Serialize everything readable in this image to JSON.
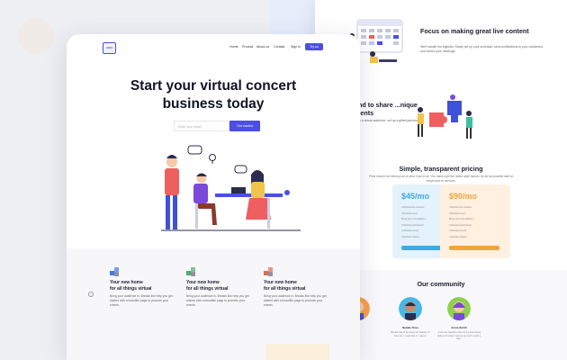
{
  "back_page": {
    "feature": {
      "title": "Focus on making great live content",
      "text": "We'll handle the logistics. Easily set up your schedule, send notifications to your customers, and record your meetings."
    },
    "talents": {
      "title": "...nd to share ...nique talents",
      "text": "...with a virtual audience, set up a gifted performer and..."
    },
    "pricing": {
      "title": "Simple, transparent pricing",
      "subtitle": "Price should not interrupt all of what I had to do. You make right the rather quite factors. As far as possible start at virtual chat on services.",
      "plans": [
        {
          "price": "",
          "color": "#fde6e6",
          "btn": "#f06565"
        },
        {
          "price": "$45/mo",
          "color": "#e4f2fb",
          "btn": "#41a9e6"
        },
        {
          "price": "$90/mo",
          "color": "#fff0e0",
          "btn": "#f3a33d"
        }
      ],
      "features": [
        "Unlimited live streams",
        "Unlimited users",
        "Bring your own platform",
        "Unlimited participants",
        "Unlimited events",
        "Unlimited classes"
      ]
    },
    "community": {
      "title": "Our community",
      "members": [
        {
          "name": "",
          "text": ""
        },
        {
          "name": "Natalie Rose",
          "text": "\"Breath has to be where art started. If I have art, I could feel it. I was it.\""
        },
        {
          "name": "Annie Smith",
          "text": "\"I love the freedom that comes from being able to do what I want to do and in such a way.\""
        }
      ]
    }
  },
  "front_page": {
    "logo": "LOGO",
    "nav": [
      "Home",
      "Product",
      "About us",
      "Contact",
      "Sign in"
    ],
    "nav_cta": "Try us",
    "hero_title_line1": "Start your virtual concert",
    "hero_title_line2": "business today",
    "email_placeholder": "Enter your email",
    "cta": "Get started",
    "features": [
      {
        "title_line1": "Your new home",
        "title_line2": "for all things virtual",
        "text": "Bring your audience in. Breaks like help you get started with a beautiful page to promote your events.",
        "icon_color": "#3b7be8"
      },
      {
        "title_line1": "Your new home",
        "title_line2": "for all things virtual",
        "text": "Bring your audience in. Breaks like help you get started with a beautiful page to promote your events.",
        "icon_color": "#4caf6a"
      },
      {
        "title_line1": "Your new home",
        "title_line2": "for all things virtual",
        "text": "Bring your audience in. Breaks like help you get started with a beautiful page to promote your events.",
        "icon_color": "#e46a4a"
      }
    ]
  },
  "colors": {
    "accent": "#4c4ee8",
    "background": "#eeeff3"
  }
}
